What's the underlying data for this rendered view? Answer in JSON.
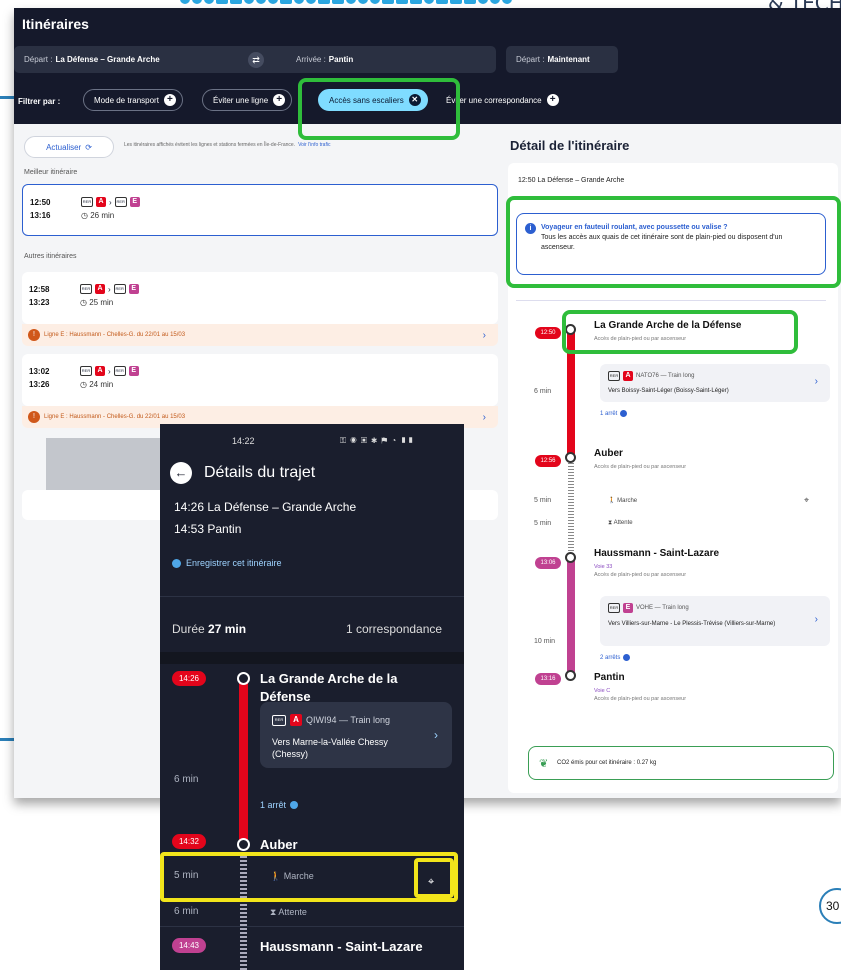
{
  "desktop": {
    "title": "Itinéraires",
    "depart_label": "Départ :",
    "depart_value": "La Défense – Grande Arche",
    "arrivee_label": "Arrivée :",
    "arrivee_value": "Pantin",
    "when_label": "Départ :",
    "when_value": "Maintenant",
    "filter_label": "Filtrer par :",
    "filters": [
      "Mode de transport",
      "Éviter une ligne",
      "Accès sans escaliers",
      "Éviter une correspondance"
    ],
    "refresh_label": "Actualiser",
    "info_text": "Les itinéraires affichés évitent les lignes et stations fermées en Île-de-France.",
    "info_link": "Voir l'info trafic",
    "best_label": "Meilleur itinéraire",
    "others_label": "Autres itinéraires",
    "itineraries": [
      {
        "dep": "12:50",
        "arr": "13:16",
        "dur": "26 min"
      },
      {
        "dep": "12:58",
        "arr": "13:23",
        "dur": "25 min"
      },
      {
        "dep": "13:02",
        "arr": "13:26",
        "dur": "24 min"
      }
    ],
    "alert_text": "Ligne E : Haussmann - Chelles-G. du 22/01 au 15/03",
    "lines": {
      "rer": "RER",
      "a": "A",
      "e": "E"
    }
  },
  "detail": {
    "title": "Détail de l'itinéraire",
    "header": "12:50 La Défense – Grande Arche",
    "notice_title": "Voyageur en fauteuil roulant, avec poussette ou valise ?",
    "notice_body": "Tous les accès aux quais de cet itinéraire sont de plain-pied ou disposent d'un ascenseur.",
    "access_text": "Accès de plain-pied ou par ascenseur",
    "stops": [
      {
        "time": "12:50",
        "name": "La Grande Arche de la Défense"
      },
      {
        "time": "12:56",
        "name": "Auber"
      },
      {
        "time": "13:06",
        "name": "Haussmann - Saint-Lazare",
        "voie": "Voie 33"
      },
      {
        "time": "13:16",
        "name": "Pantin",
        "voie": "Voie C"
      }
    ],
    "train1": {
      "code": "NATO76 — Train long",
      "dir": "Vers Boissy-Saint-Léger (Boissy-Saint-Léger)",
      "dur": "6 min",
      "stops": "1 arrêt"
    },
    "walk": {
      "dur1": "5 min",
      "label1": "Marche",
      "dur2": "5 min",
      "label2": "Attente"
    },
    "train2": {
      "code": "VOHE — Train long",
      "dir": "Vers Villiers-sur-Marne - Le Plessis-Trévise (Villiers-sur-Marne)",
      "dur": "10 min",
      "stops": "2 arrêts"
    },
    "co2": "CO2 émis pour cet itinéraire : 0.27 kg",
    "colors": {
      "lineA": "#e3051b",
      "lineE": "#c04191"
    }
  },
  "phone": {
    "status_time": "14:22",
    "title": "Détails du trajet",
    "from_time": "14:26",
    "from_name": "La Défense – Grande Arche",
    "to_time": "14:53",
    "to_name": "Pantin",
    "save": "Enregistrer cet itinéraire",
    "duration_label": "Durée",
    "duration_value": "27 min",
    "correspondances": "1 correspondance",
    "stop1_time": "14:26",
    "stop1_name_l1": "La Grande Arche de la",
    "stop1_name_l2": "Défense",
    "train_code": "QIWI94 — Train long",
    "train_dir_l1": "Vers Marne-la-Vallée Chessy",
    "train_dir_l2": "(Chessy)",
    "train_dur": "6 min",
    "stops_count": "1 arrêt",
    "stop2_time": "14:32",
    "stop2_name": "Auber",
    "walk_dur": "5 min",
    "walk_label": "Marche",
    "wait_dur": "6 min",
    "wait_label": "Attente",
    "stop3_time": "14:43",
    "stop3_name": "Haussmann - Saint-Lazare"
  },
  "slide": {
    "page_number": "30",
    "brand": "& TECH"
  }
}
